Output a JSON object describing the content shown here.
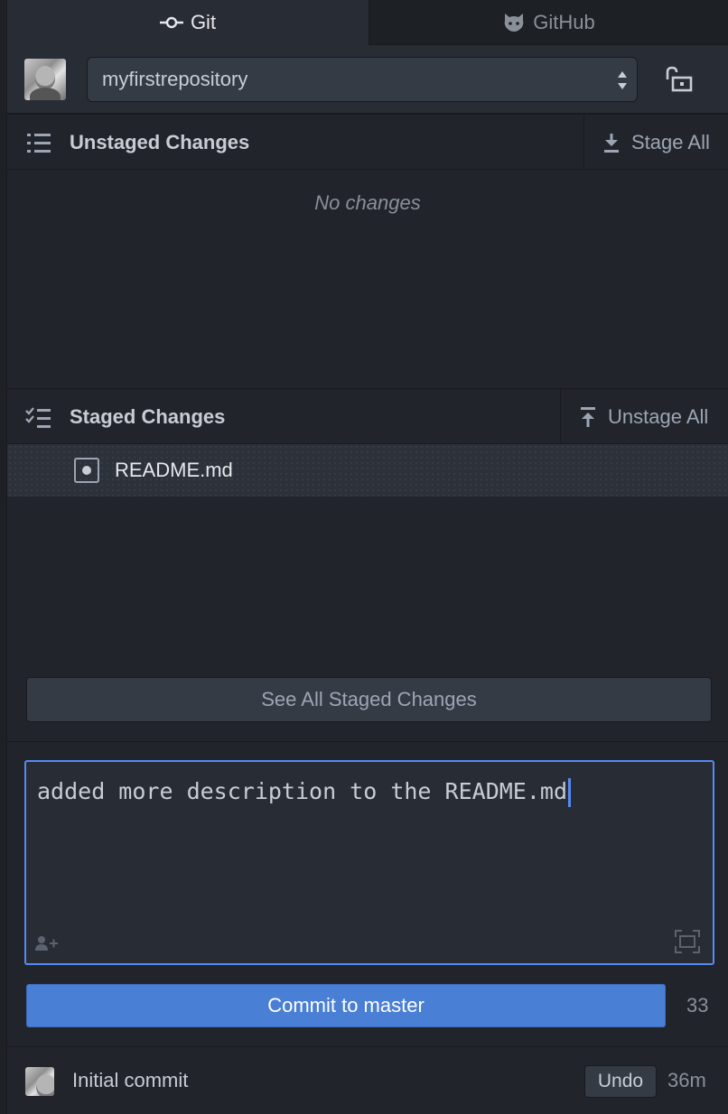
{
  "tabs": {
    "git": {
      "label": "Git",
      "icon": "git-commit-icon"
    },
    "github": {
      "label": "GitHub",
      "icon": "octocat-icon"
    }
  },
  "repo": {
    "selected": "myfirstrepository",
    "lock_icon": "unlock-icon"
  },
  "unstaged": {
    "title": "Unstaged Changes",
    "action_label": "Stage All",
    "empty_text": "No changes"
  },
  "staged": {
    "title": "Staged Changes",
    "action_label": "Unstage All",
    "files": [
      {
        "name": "README.md",
        "status": "modified"
      }
    ],
    "see_all_label": "See All Staged Changes"
  },
  "commit": {
    "message": "added more description to the README.md",
    "button_label": "Commit to master",
    "remaining_chars": "33"
  },
  "recent_commit": {
    "message": "Initial commit",
    "undo_label": "Undo",
    "time": "36m"
  },
  "colors": {
    "background": "#21252b",
    "panel": "#282c34",
    "accent": "#568af2",
    "commit_button": "#4a7fd6"
  }
}
